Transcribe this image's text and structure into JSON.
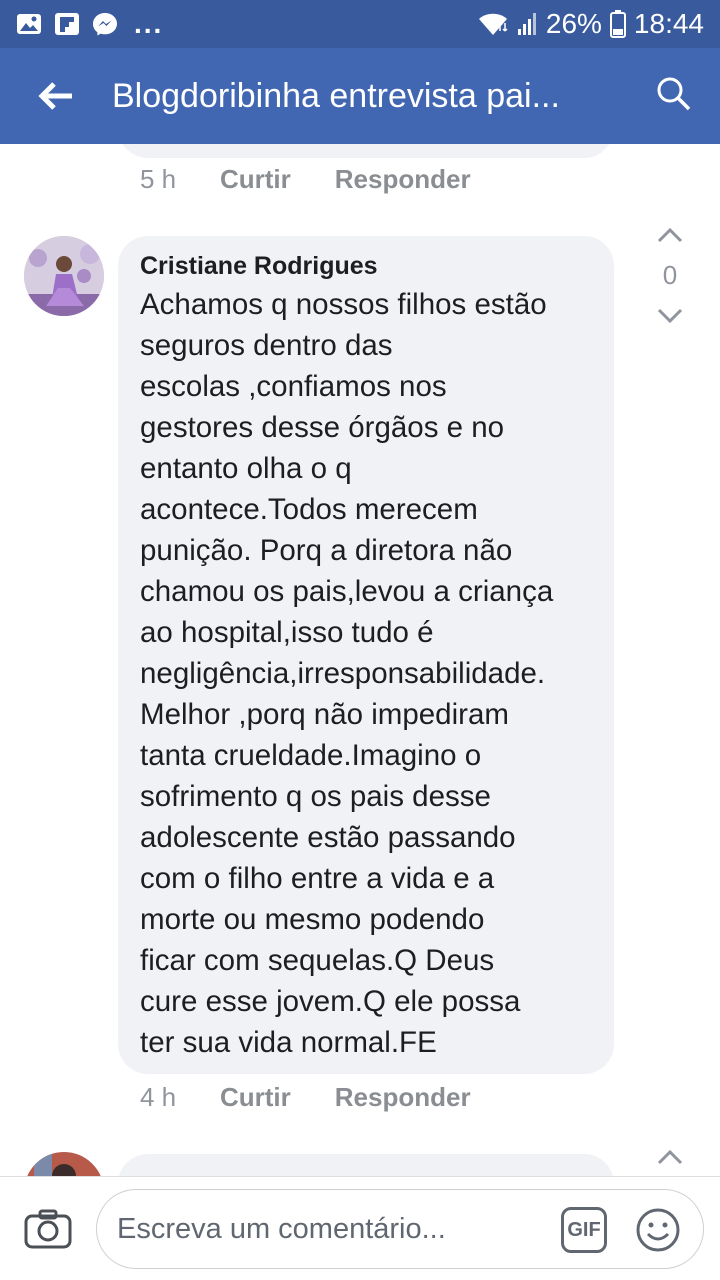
{
  "status_bar": {
    "battery": "26%",
    "time": "18:44",
    "left_icons": [
      "image-icon",
      "flipboard-icon",
      "messenger-icon",
      "more-dots-icon"
    ],
    "more_text": "..."
  },
  "app_bar": {
    "title": "Blogdoribinha entrevista pai..."
  },
  "previous_comment": {
    "time": "5 h",
    "like_label": "Curtir",
    "reply_label": "Responder"
  },
  "comment": {
    "author": "Cristiane Rodrigues",
    "text": "Achamos q nossos filhos estão\nseguros dentro das\nescolas ,confiamos nos\ngestores desse órgãos e no\nentanto olha o q\nacontece.Todos merecem\npunição. Porq a diretora não\nchamou os pais,levou a criança\nao hospital,isso tudo é\nnegligência,irresponsabilidade.\nMelhor ,porq não impediram\ntanta crueldade.Imagino o\nsofrimento q os pais desse\nadolescente estão passando\ncom o filho entre a vida e a\n morte ou mesmo podendo\nficar com sequelas.Q Deus\ncure esse jovem.Q ele possa\nter sua vida normal.FE",
    "vote_count": "0",
    "time": "4 h",
    "like_label": "Curtir",
    "reply_label": "Responder"
  },
  "composer": {
    "placeholder": "Escreva um comentário...",
    "gif_label": "GIF"
  },
  "colors": {
    "status_bar": "#3a5a9e",
    "app_bar": "#4267b2",
    "bubble": "#f0f2f5",
    "meta_text": "#90949c"
  }
}
